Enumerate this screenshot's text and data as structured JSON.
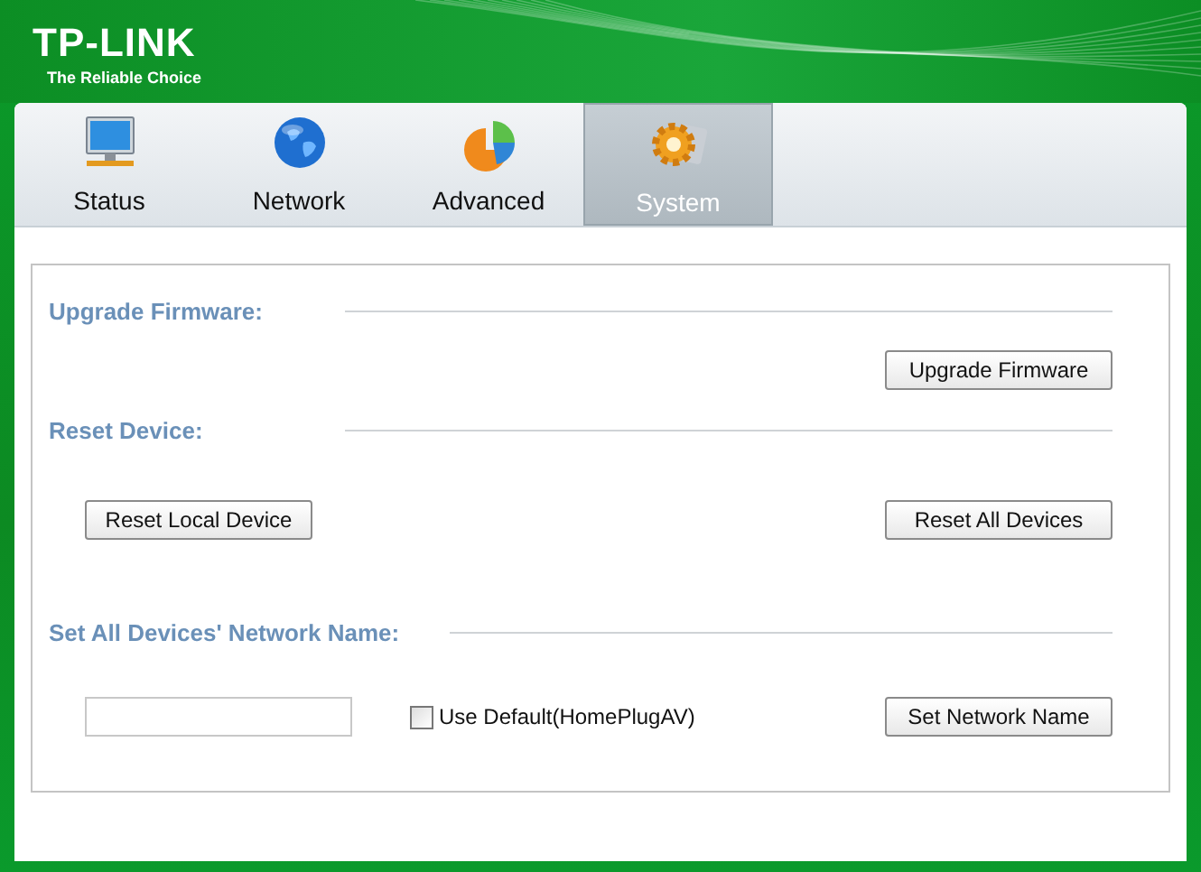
{
  "header": {
    "logo": "TP-LINK",
    "tagline": "The Reliable Choice"
  },
  "tabs": [
    {
      "label": "Status",
      "kind": "monitor",
      "selected": false
    },
    {
      "label": "Network",
      "kind": "globe",
      "selected": false
    },
    {
      "label": "Advanced",
      "kind": "chart",
      "selected": false
    },
    {
      "label": "System",
      "kind": "gear",
      "selected": true
    }
  ],
  "sections": [
    {
      "heading": "Upgrade Firmware:",
      "controls": [
        {
          "kind": "button",
          "label": "Upgrade Firmware"
        }
      ]
    },
    {
      "heading": "Reset Device:",
      "controls": [
        {
          "kind": "button",
          "label": "Reset Local Device"
        },
        {
          "kind": "button",
          "label": "Reset All Devices"
        }
      ]
    },
    {
      "heading": "Set All Devices' Network Name:",
      "controls": [
        {
          "kind": "field"
        },
        {
          "kind": "checkbox",
          "label": "Use Default(HomePlugAV)",
          "checked": false
        },
        {
          "kind": "button",
          "label": "Set Network Name"
        }
      ]
    }
  ]
}
